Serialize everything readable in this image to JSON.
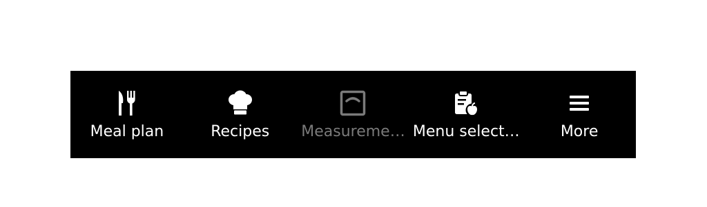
{
  "bottom_nav": {
    "items": [
      {
        "label": "Meal plan",
        "icon": "fork-knife-icon",
        "enabled": true
      },
      {
        "label": "Recipes",
        "icon": "chef-hat-icon",
        "enabled": true
      },
      {
        "label": "Measureme…",
        "icon": "scale-icon",
        "enabled": false
      },
      {
        "label": "Menu select…",
        "icon": "clipboard-apple-icon",
        "enabled": true
      },
      {
        "label": "More",
        "icon": "menu-icon",
        "enabled": true
      }
    ]
  },
  "colors": {
    "bar_background": "#000000",
    "active_text": "#ffffff",
    "disabled_text": "#7a7a7a"
  }
}
